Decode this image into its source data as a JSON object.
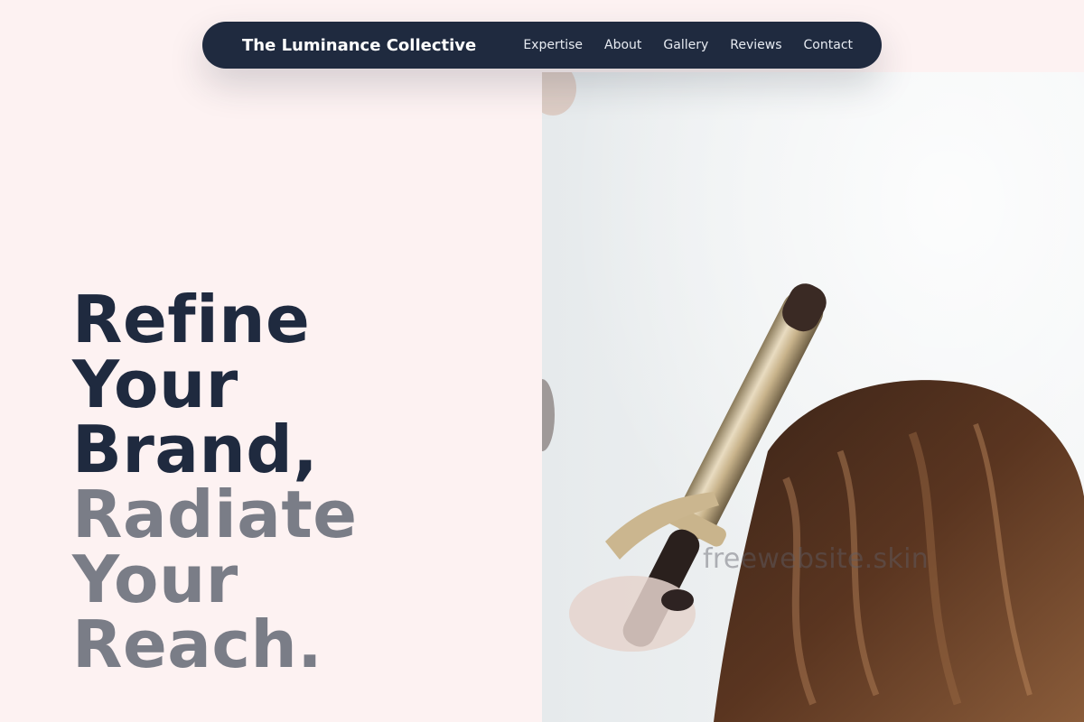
{
  "nav": {
    "brand": "The Luminance Collective",
    "links": [
      "Expertise",
      "About",
      "Gallery",
      "Reviews",
      "Contact"
    ]
  },
  "hero": {
    "headline_dark": [
      "Refine",
      "Your",
      "Brand,"
    ],
    "headline_muted": [
      "Radiate",
      "Your",
      "Reach."
    ],
    "watermark": "freewebsite.skin"
  },
  "colors": {
    "page_background": "#fdf2f2",
    "nav_background": "#1f2a3f",
    "headline_primary": "#1f2a3f",
    "headline_secondary": "#7a7d87"
  },
  "icons": {
    "hero_photo": "hair-curling-iron-photo"
  }
}
